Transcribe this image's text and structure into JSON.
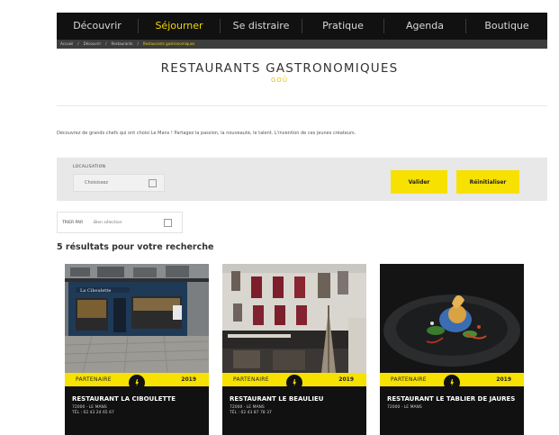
{
  "nav": {
    "items": [
      {
        "label": "Découvrir",
        "active": false
      },
      {
        "label": "Séjourner",
        "active": true
      },
      {
        "label": "Se distraire",
        "active": false
      },
      {
        "label": "Pratique",
        "active": false
      },
      {
        "label": "Agenda",
        "active": false
      },
      {
        "label": "Boutique",
        "active": false
      }
    ],
    "accent": "#f2d500"
  },
  "breadcrumb": [
    "Accueil",
    "Découvrir",
    "Restaurants",
    "Restaurants gastronomiques"
  ],
  "header": {
    "title": "RESTAURANTS GASTRONOMIQUES",
    "subtitle": "GOÛ"
  },
  "intro_text": "Découvrez de grands chefs qui ont choisi Le Mans ! Partagez la passion, la nouveauté, le talent. L'invention de ces jeunes créateurs.",
  "filter": {
    "location_label": "LOCALISATION",
    "location_value": "Choisissez",
    "validate_label": "Valider",
    "reset_label": "Réinitialiser"
  },
  "sort": {
    "label": "TRIER PAR",
    "value": "Bien sélection"
  },
  "results": {
    "count_text": "5 résultats pour votre recherche",
    "cards": [
      {
        "partner_label": "PARTENAIRE",
        "year": "2019",
        "name": "RESTAURANT LA CIBOULETTE",
        "city": "72000 - LE MANS",
        "phone": "TÉL : 02 43 24 65 67"
      },
      {
        "partner_label": "PARTENAIRE",
        "year": "2019",
        "name": "RESTAURANT LE BEAULIEU",
        "city": "72000 - LE MANS",
        "phone": "TÉL : 02 43 87 78 37"
      },
      {
        "partner_label": "PARTENAIRE",
        "year": "2019",
        "name": "RESTAURANT LE TABLIER DE JAURES",
        "city": "72000 - LE MANS",
        "phone": ""
      }
    ]
  },
  "colors": {
    "brand_yellow": "#f7e100",
    "dark": "#111111"
  }
}
